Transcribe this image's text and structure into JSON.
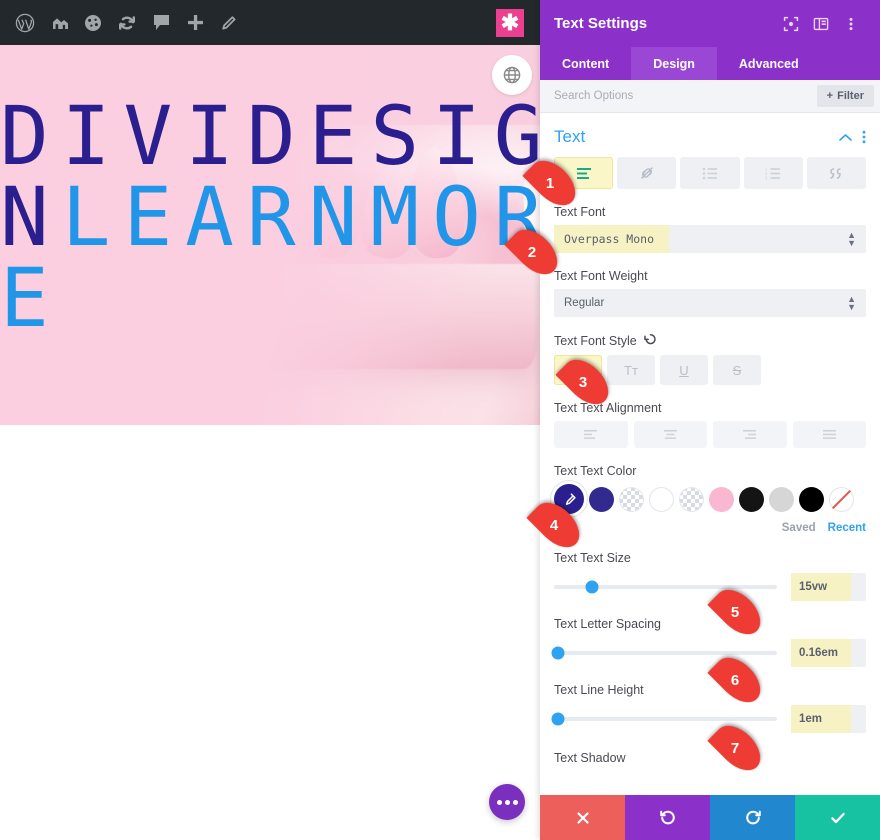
{
  "adminbar": {
    "icons": [
      "wordpress-logo-icon",
      "home-icon",
      "dashboard-speed-icon",
      "refresh-icon",
      "comment-icon",
      "plus-icon",
      "pencil-icon"
    ],
    "badge": "✱"
  },
  "hero": {
    "line_navy": "DIVIDESIGN",
    "line_blue": "LEARNMORE",
    "globe_icon": "globe-icon",
    "dots_label": "•••"
  },
  "panel": {
    "title": "Text Settings",
    "header_icons": [
      "fullscreen-icon",
      "layout-columns-icon",
      "kebab-menu-icon"
    ],
    "tabs": [
      {
        "label": "Content",
        "active": false
      },
      {
        "label": "Design",
        "active": true
      },
      {
        "label": "Advanced",
        "active": false
      }
    ],
    "search": {
      "placeholder": "Search Options",
      "value": ""
    },
    "filter_label": "Filter",
    "section": {
      "title": "Text",
      "toolbar": [
        {
          "name": "paragraph-text-icon",
          "active": true
        },
        {
          "name": "link-icon",
          "active": false
        },
        {
          "name": "unordered-list-icon",
          "active": false
        },
        {
          "name": "ordered-list-icon",
          "active": false
        },
        {
          "name": "blockquote-icon",
          "active": false
        }
      ]
    },
    "fields": {
      "font_label": "Text Font",
      "font_value": "Overpass Mono",
      "weight_label": "Text Font Weight",
      "weight_value": "Regular",
      "style_label": "Text Font Style",
      "style_buttons": [
        {
          "label": "TT",
          "name": "uppercase-button",
          "active": true
        },
        {
          "label": "Tт",
          "name": "smallcaps-button",
          "active": false
        },
        {
          "label": "U",
          "name": "underline-button",
          "active": false
        },
        {
          "label": "S",
          "name": "strikethrough-button",
          "active": false
        }
      ],
      "alignment_label": "Text Text Alignment",
      "alignment_buttons": [
        "align-left-button",
        "align-center-button",
        "align-right-button",
        "align-justify-button"
      ],
      "color_label": "Text Text Color",
      "color_swatches": [
        {
          "name": "color-picker-eyedropper",
          "hex": "#2b1f8f",
          "kind": "picker"
        },
        {
          "name": "swatch-navy",
          "hex": "#332a8f",
          "kind": "solid"
        },
        {
          "name": "swatch-transparent-1",
          "hex": "transparent",
          "kind": "checker"
        },
        {
          "name": "swatch-white",
          "hex": "#ffffff",
          "kind": "white"
        },
        {
          "name": "swatch-transparent-2",
          "hex": "transparent",
          "kind": "checker"
        },
        {
          "name": "swatch-pink",
          "hex": "#f9b7d0",
          "kind": "solid"
        },
        {
          "name": "swatch-black-1",
          "hex": "#141414",
          "kind": "solid"
        },
        {
          "name": "swatch-lightgray",
          "hex": "#d6d6d6",
          "kind": "solid"
        },
        {
          "name": "swatch-black-2",
          "hex": "#000000",
          "kind": "solid"
        },
        {
          "name": "swatch-no-color",
          "hex": "none",
          "kind": "none"
        }
      ],
      "saved_label": "Saved",
      "recent_label": "Recent",
      "size_label": "Text Text Size",
      "size_value": "15vw",
      "size_percent": 17,
      "spacing_label": "Text Letter Spacing",
      "spacing_value": "0.16em",
      "spacing_percent": 2,
      "lineheight_label": "Text Line Height",
      "lineheight_value": "1em",
      "lineheight_percent": 2,
      "shadow_label": "Text Shadow"
    },
    "footer": [
      {
        "name": "cancel-button",
        "icon": "close-icon",
        "color": "#ec5f5a"
      },
      {
        "name": "undo-button",
        "icon": "undo-icon",
        "color": "#8b30c9"
      },
      {
        "name": "redo-button",
        "icon": "redo-icon",
        "color": "#2187cf"
      },
      {
        "name": "save-button",
        "icon": "check-icon",
        "color": "#17c2a3"
      }
    ]
  },
  "markers": [
    {
      "num": "1"
    },
    {
      "num": "2"
    },
    {
      "num": "3"
    },
    {
      "num": "4"
    },
    {
      "num": "5"
    },
    {
      "num": "6"
    },
    {
      "num": "7"
    }
  ],
  "colors": {
    "divi_purple": "#8b30c9",
    "accent_blue": "#2ea3f2",
    "highlight_yellow": "#f7f2c4",
    "marker_red": "#ee3b33",
    "hero_navy": "#2b1f8f",
    "hero_blue": "#2196e8",
    "hero_pink": "#fbcfe0"
  }
}
